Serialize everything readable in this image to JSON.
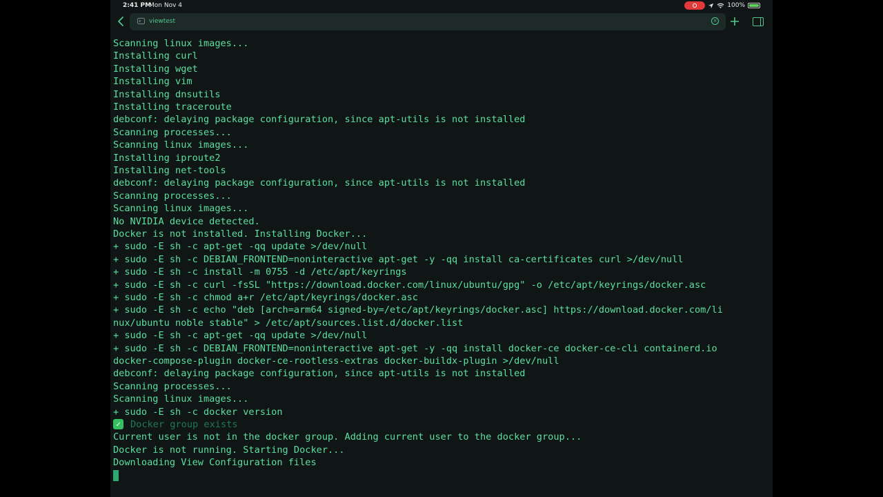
{
  "status_bar": {
    "time": "2:41 PM",
    "date": "Mon Nov 4",
    "battery": "100%",
    "battery_level": 1.0
  },
  "toolbar": {
    "url": "viewtest"
  },
  "colors": {
    "terminal_bg": "#101516",
    "terminal_text": "#5ce0a0",
    "accent": "#4fc98d",
    "record": "#e03a3a"
  },
  "terminal": {
    "lines": [
      {
        "text": "Scanning linux images..."
      },
      {
        "text": "Installing curl"
      },
      {
        "text": "Installing wget"
      },
      {
        "text": "Installing vim"
      },
      {
        "text": "Installing dnsutils"
      },
      {
        "text": "Installing traceroute"
      },
      {
        "text": "debconf: delaying package configuration, since apt-utils is not installed"
      },
      {
        "text": "Scanning processes..."
      },
      {
        "text": "Scanning linux images..."
      },
      {
        "text": "Installing iproute2"
      },
      {
        "text": "Installing net-tools"
      },
      {
        "text": "debconf: delaying package configuration, since apt-utils is not installed"
      },
      {
        "text": "Scanning processes..."
      },
      {
        "text": "Scanning linux images..."
      },
      {
        "text": "No NVIDIA device detected."
      },
      {
        "text": "Docker is not installed. Installing Docker..."
      },
      {
        "text": "+ sudo -E sh -c apt-get -qq update >/dev/null"
      },
      {
        "text": "+ sudo -E sh -c DEBIAN_FRONTEND=noninteractive apt-get -y -qq install ca-certificates curl >/dev/null"
      },
      {
        "text": "+ sudo -E sh -c install -m 0755 -d /etc/apt/keyrings"
      },
      {
        "text": "+ sudo -E sh -c curl -fsSL \"https://download.docker.com/linux/ubuntu/gpg\" -o /etc/apt/keyrings/docker.asc"
      },
      {
        "text": "+ sudo -E sh -c chmod a+r /etc/apt/keyrings/docker.asc"
      },
      {
        "text": "+ sudo -E sh -c echo \"deb [arch=arm64 signed-by=/etc/apt/keyrings/docker.asc] https://download.docker.com/li"
      },
      {
        "text": "nux/ubuntu noble stable\" > /etc/apt/sources.list.d/docker.list"
      },
      {
        "text": "+ sudo -E sh -c apt-get -qq update >/dev/null"
      },
      {
        "text": "+ sudo -E sh -c DEBIAN_FRONTEND=noninteractive apt-get -y -qq install docker-ce docker-ce-cli containerd.io"
      },
      {
        "text": "docker-compose-plugin docker-ce-rootless-extras docker-buildx-plugin >/dev/null"
      },
      {
        "text": "debconf: delaying package configuration, since apt-utils is not installed"
      },
      {
        "text": "Scanning processes..."
      },
      {
        "text": "Scanning linux images..."
      },
      {
        "text": "+ sudo -E sh -c docker version"
      },
      {
        "text": "Docker group exists",
        "icon": "check-mark-icon",
        "dim": true
      },
      {
        "text": "Current user is not in the docker group. Adding current user to the docker group..."
      },
      {
        "text": "Docker is not running. Starting Docker..."
      },
      {
        "text": "Downloading View Configuration files"
      }
    ]
  }
}
